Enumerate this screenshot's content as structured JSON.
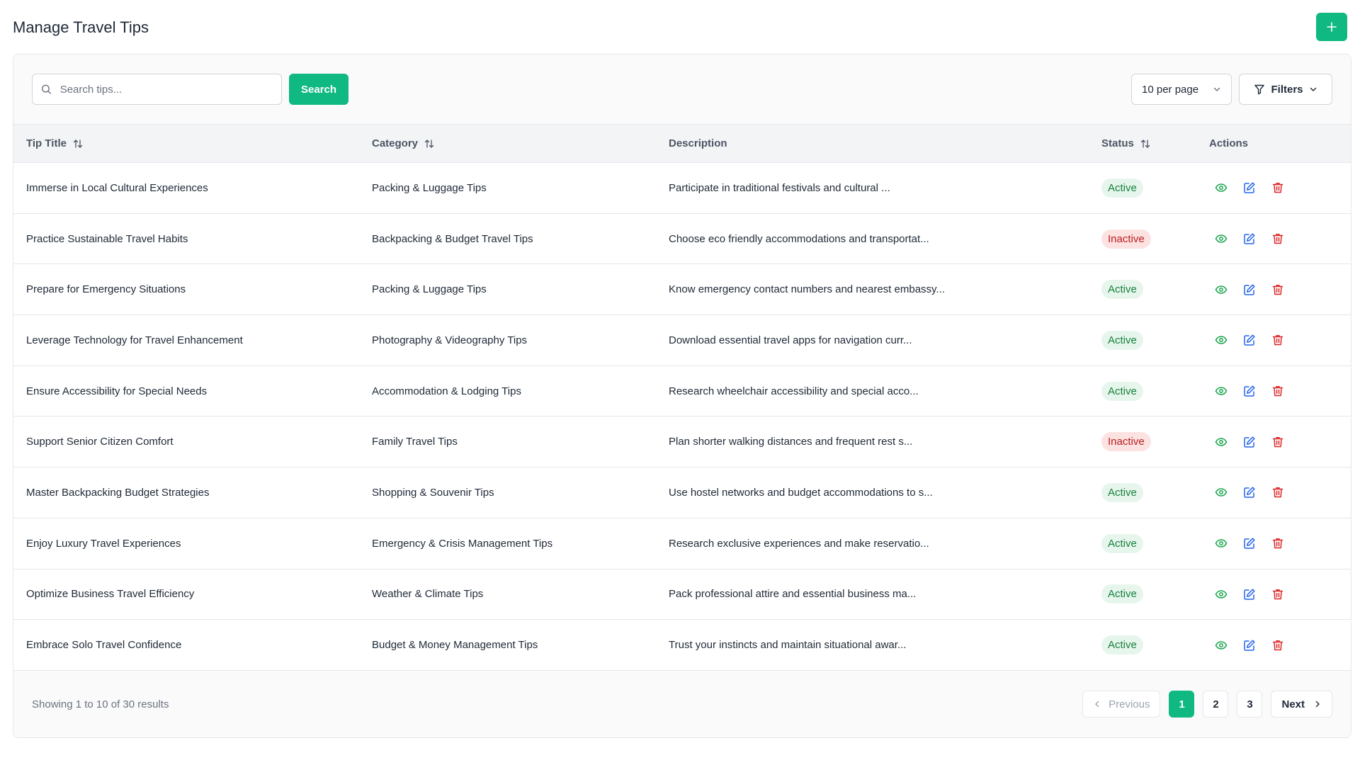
{
  "header": {
    "title": "Manage Travel Tips",
    "add_label": "+"
  },
  "toolbar": {
    "search_placeholder": "Search tips...",
    "search_label": "Search",
    "per_page": "10 per page",
    "filters_label": "Filters"
  },
  "table": {
    "columns": [
      "Tip Title",
      "Category",
      "Description",
      "Status",
      "Actions"
    ],
    "rows": [
      {
        "title": "Immerse in Local Cultural Experiences",
        "category": "Packing & Luggage Tips",
        "description": "Participate in traditional festivals and cultural ...",
        "status": "Active"
      },
      {
        "title": "Practice Sustainable Travel Habits",
        "category": "Backpacking & Budget Travel Tips",
        "description": "Choose eco friendly accommodations and transportat...",
        "status": "Inactive"
      },
      {
        "title": "Prepare for Emergency Situations",
        "category": "Packing & Luggage Tips",
        "description": "Know emergency contact numbers and nearest embassy...",
        "status": "Active"
      },
      {
        "title": "Leverage Technology for Travel Enhancement",
        "category": "Photography & Videography Tips",
        "description": "Download essential travel apps for navigation curr...",
        "status": "Active"
      },
      {
        "title": "Ensure Accessibility for Special Needs",
        "category": "Accommodation & Lodging Tips",
        "description": "Research wheelchair accessibility and special acco...",
        "status": "Active"
      },
      {
        "title": "Support Senior Citizen Comfort",
        "category": "Family Travel Tips",
        "description": "Plan shorter walking distances and frequent rest s...",
        "status": "Inactive"
      },
      {
        "title": "Master Backpacking Budget Strategies",
        "category": "Shopping & Souvenir Tips",
        "description": "Use hostel networks and budget accommodations to s...",
        "status": "Active"
      },
      {
        "title": "Enjoy Luxury Travel Experiences",
        "category": "Emergency & Crisis Management Tips",
        "description": "Research exclusive experiences and make reservatio...",
        "status": "Active"
      },
      {
        "title": "Optimize Business Travel Efficiency",
        "category": "Weather & Climate Tips",
        "description": "Pack professional attire and essential business ma...",
        "status": "Active"
      },
      {
        "title": "Embrace Solo Travel Confidence",
        "category": "Budget & Money Management Tips",
        "description": "Trust your instincts and maintain situational awar...",
        "status": "Active"
      }
    ]
  },
  "footer": {
    "results": "Showing 1 to 10 of 30 results",
    "previous": "Previous",
    "pages": [
      "1",
      "2",
      "3"
    ],
    "current_page": "1",
    "next": "Next"
  },
  "colors": {
    "accent": "#10b981",
    "active_bg": "#e7f6ec",
    "active_text": "#15803d",
    "inactive_bg": "#fde2e2",
    "inactive_text": "#b91c1c",
    "view_icon": "#16a34a",
    "edit_icon": "#2563eb",
    "delete_icon": "#dc2626"
  },
  "icons": {
    "add": "plus-icon",
    "search": "search-icon",
    "per_page": "chevron-down-icon",
    "filters": "filter-icon",
    "sort": "sort-icon",
    "view": "eye-icon",
    "edit": "edit-icon",
    "delete": "trash-icon",
    "previous": "chevron-left-icon",
    "next": "chevron-right-icon"
  }
}
